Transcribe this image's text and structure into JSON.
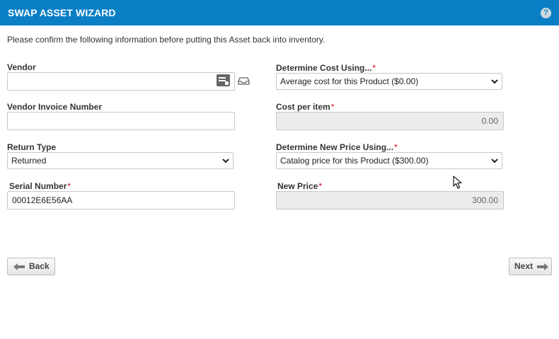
{
  "header": {
    "title": "SWAP ASSET WIZARD",
    "help_glyph": "?"
  },
  "intro": "Please confirm the following information before putting this Asset back into inventory.",
  "form": {
    "vendor": {
      "label": "Vendor",
      "value": ""
    },
    "vendor_invoice_number": {
      "label": "Vendor Invoice Number",
      "value": ""
    },
    "return_type": {
      "label": "Return Type",
      "selected": "Returned"
    },
    "serial_number": {
      "label": "Serial Number",
      "required_mark": "*",
      "value": "00012E6E56AA"
    },
    "determine_cost_using": {
      "label": "Determine Cost Using...",
      "required_mark": "*",
      "selected": "Average cost for this Product ($0.00)"
    },
    "cost_per_item": {
      "label": "Cost per item",
      "required_mark": "*",
      "value": "0.00"
    },
    "determine_new_price_using": {
      "label": "Determine New Price Using...",
      "required_mark": "*",
      "selected": "Catalog price for this Product ($300.00)"
    },
    "new_price": {
      "label": "New Price",
      "required_mark": "*",
      "value": "300.00"
    }
  },
  "buttons": {
    "back": "Back",
    "next": "Next"
  },
  "icons": {
    "help": "help-icon",
    "vendor_picker": "list-picker-icon",
    "vendor_tray": "tray-icon",
    "back_arrow": "arrow-left-icon",
    "next_arrow": "arrow-right-icon",
    "select_chevron": "chevron-down-icon"
  },
  "colors": {
    "header_bg": "#0a7fc6",
    "required": "#d0021b",
    "readonly_bg": "#ececec"
  }
}
